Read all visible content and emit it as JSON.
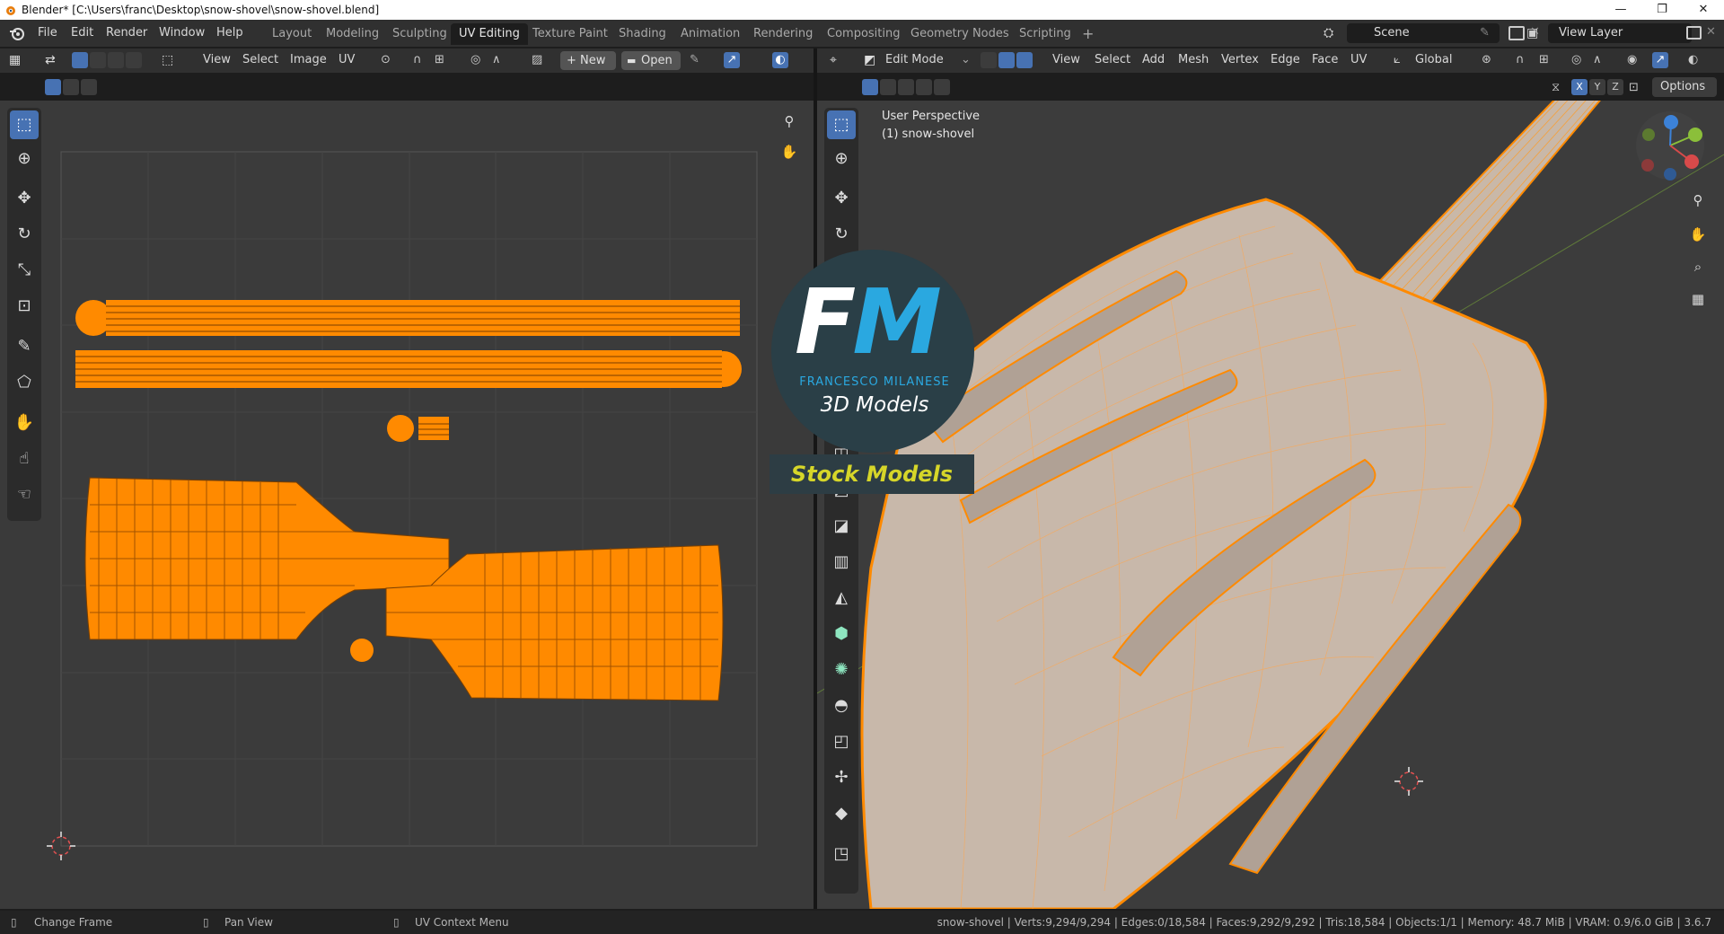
{
  "window": {
    "title": "Blender* [C:\\Users\\franc\\Desktop\\snow-shovel\\snow-shovel.blend]",
    "minimize": "—",
    "maximize": "❐",
    "close": "✕"
  },
  "menubar": {
    "items": [
      "File",
      "Edit",
      "Render",
      "Window",
      "Help"
    ]
  },
  "workspaces": {
    "tabs": [
      "Layout",
      "Modeling",
      "Sculpting",
      "UV Editing",
      "Texture Paint",
      "Shading",
      "Animation",
      "Rendering",
      "Compositing",
      "Geometry Nodes",
      "Scripting"
    ],
    "active": "UV Editing",
    "add": "+"
  },
  "scene": {
    "label": "Scene",
    "view_layer": "View Layer"
  },
  "uv_header": {
    "menus": [
      "View",
      "Select",
      "Image",
      "UV"
    ],
    "new_label": "New",
    "open_label": "Open"
  },
  "vp_header": {
    "mode": "Edit Mode",
    "menus": [
      "View",
      "Select",
      "Add",
      "Mesh",
      "Vertex",
      "Edge",
      "Face",
      "UV"
    ],
    "orientation": "Global",
    "axes": [
      "X",
      "Y",
      "Z"
    ],
    "options": "Options"
  },
  "viewport": {
    "perspective": "User Perspective",
    "object": "(1) snow-shovel"
  },
  "watermark": {
    "logo_f": "F",
    "logo_m": "M",
    "name": "FRANCESCO MILANESE",
    "subtitle": "3D Models",
    "stock": "Stock Models"
  },
  "statusbar": {
    "change_frame": "Change Frame",
    "pan_view": "Pan View",
    "context_menu": "UV Context Menu",
    "stats": "snow-shovel | Verts:9,294/9,294 | Edges:0/18,584 | Faces:9,292/9,292 | Tris:18,584 | Objects:1/1 | Memory: 48.7 MiB | VRAM: 0.9/6.0 GiB | 3.6.7"
  },
  "colors": {
    "accent_blue": "#4772b3",
    "uv_orange": "#ff8a00",
    "fm_blue": "#2aa8e0",
    "stock_yellow": "#d6d629"
  }
}
